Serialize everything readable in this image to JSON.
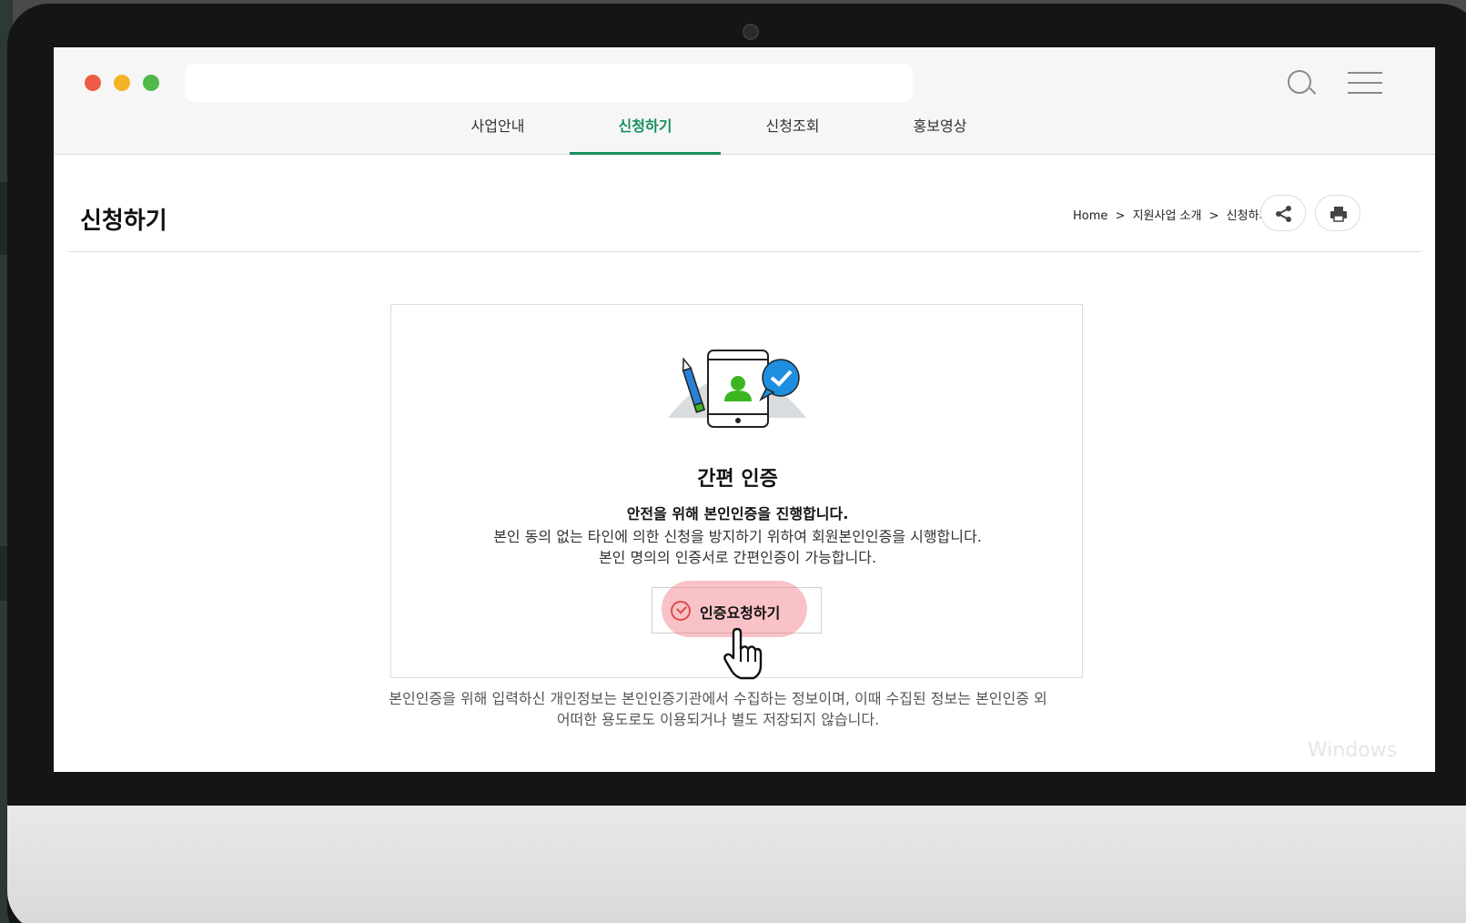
{
  "nav": {
    "tabs": [
      {
        "label": "사업안내",
        "active": false
      },
      {
        "label": "신청하기",
        "active": true
      },
      {
        "label": "신청조회",
        "active": false
      },
      {
        "label": "홍보영상",
        "active": false
      }
    ]
  },
  "page": {
    "title": "신청하기",
    "breadcrumb": [
      "Home",
      ">",
      "지원사업 소개",
      ">",
      "신청하기"
    ]
  },
  "auth": {
    "title": "간편 인증",
    "subtitle": "안전을 위해 본인인증을 진행합니다.",
    "description_line1": "본인 동의 없는 타인에 의한 신청을 방지하기 위하여 회원본인인증을 시행합니다.",
    "description_line2": "본인 명의의 인증서로 간편인증이 가능합니다.",
    "button_label": "인증요청하기"
  },
  "footnote": {
    "line1": "본인인증을 위해 입력하신 개인정보는 본인인증기관에서 수집하는 정보이며, 이때 수집된 정보는 본인인증 외",
    "line2": "어떠한 용도로도 이용되거나 별도 저장되지 않습니다."
  },
  "watermark": "Windows",
  "colors": {
    "accent": "#15905f",
    "highlight": "#f0787f",
    "person": "#3cb521",
    "bubble": "#1e8fe0"
  },
  "icons": [
    "search-icon",
    "menu-icon",
    "share-icon",
    "print-icon",
    "check-circle-icon",
    "hand-cursor-icon"
  ]
}
